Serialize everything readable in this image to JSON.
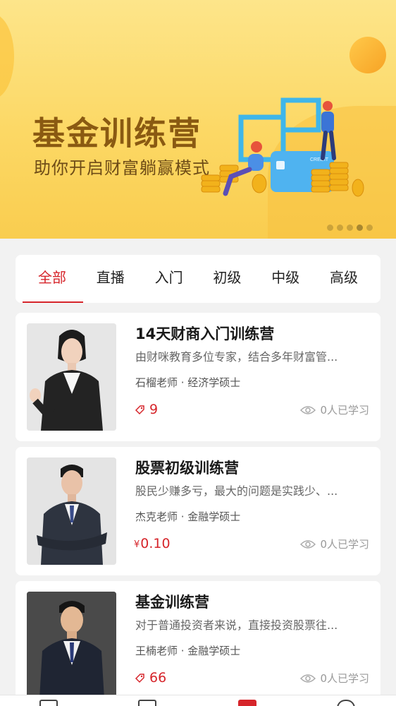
{
  "banner": {
    "title": "基金训练营",
    "subtitle": "助你开启财富躺赢模式",
    "card_text": "CREDIT",
    "slide_count": 5,
    "active_slide": 4
  },
  "tabs": [
    {
      "label": "全部",
      "active": true
    },
    {
      "label": "直播",
      "active": false
    },
    {
      "label": "入门",
      "active": false
    },
    {
      "label": "初级",
      "active": false
    },
    {
      "label": "中级",
      "active": false
    },
    {
      "label": "高级",
      "active": false
    }
  ],
  "courses": [
    {
      "title": "14天财商入门训练营",
      "desc": "由财咪教育多位专家，结合多年财富管...",
      "teacher": "石榴老师 · 经济学硕士",
      "price_type": "coin",
      "price": "9",
      "learners": "0人已学习"
    },
    {
      "title": "股票初级训练营",
      "desc": "股民少赚多亏，最大的问题是实践少、...",
      "teacher": "杰克老师 · 金融学硕士",
      "price_type": "yen",
      "currency": "¥",
      "price": "0.10",
      "learners": "0人已学习"
    },
    {
      "title": "基金训练营",
      "desc": "对于普通投资者来说，直接投资股票往...",
      "teacher": "王楠老师 · 金融学硕士",
      "price_type": "coin",
      "price": "66",
      "learners": "0人已学习"
    }
  ],
  "colors": {
    "accent": "#d6252b",
    "banner_title": "#8a5a12",
    "banner_bg": "#fcd865"
  },
  "icons": {
    "price_icon": "coin-tag-icon",
    "learners_icon": "eye-icon"
  }
}
